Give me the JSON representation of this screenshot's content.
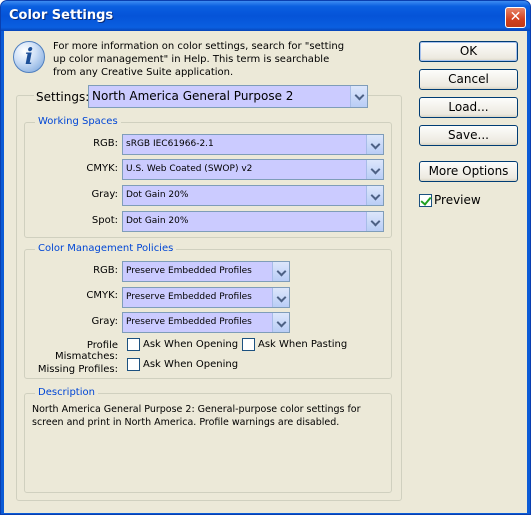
{
  "window": {
    "title": "Color Settings",
    "close_glyph": "✕"
  },
  "info": {
    "icon": "info-icon",
    "glyph": "i",
    "text": "For more information on color settings, search for \"setting up color management\" in Help. This term is searchable from any Creative Suite application."
  },
  "buttons": {
    "ok": "OK",
    "cancel": "Cancel",
    "load": "Load...",
    "save": "Save...",
    "more_options": "More Options"
  },
  "preview": {
    "label": "Preview",
    "checked": true
  },
  "settings": {
    "label": "Settings:",
    "value": "North America General Purpose 2"
  },
  "working_spaces": {
    "title": "Working Spaces",
    "rgb": {
      "label": "RGB:",
      "value": "sRGB IEC61966-2.1"
    },
    "cmyk": {
      "label": "CMYK:",
      "value": "U.S. Web Coated (SWOP) v2"
    },
    "gray": {
      "label": "Gray:",
      "value": "Dot Gain 20%"
    },
    "spot": {
      "label": "Spot:",
      "value": "Dot Gain 20%"
    }
  },
  "policies": {
    "title": "Color Management Policies",
    "rgb": {
      "label": "RGB:",
      "value": "Preserve Embedded Profiles"
    },
    "cmyk": {
      "label": "CMYK:",
      "value": "Preserve Embedded Profiles"
    },
    "gray": {
      "label": "Gray:",
      "value": "Preserve Embedded Profiles"
    },
    "profile_mismatches": {
      "label": "Profile Mismatches:",
      "ask_opening": "Ask When Opening",
      "ask_pasting": "Ask When Pasting"
    },
    "missing_profiles": {
      "label": "Missing Profiles:",
      "ask_opening": "Ask When Opening"
    }
  },
  "description": {
    "title": "Description",
    "text": "North America General Purpose 2:  General-purpose color settings for screen and print in North America. Profile warnings are disabled."
  },
  "colors": {
    "title_bar": "#0553d8",
    "dialog_bg": "#ece9d8",
    "select_bg": "#cbcbff",
    "group_title": "#0046d5"
  }
}
